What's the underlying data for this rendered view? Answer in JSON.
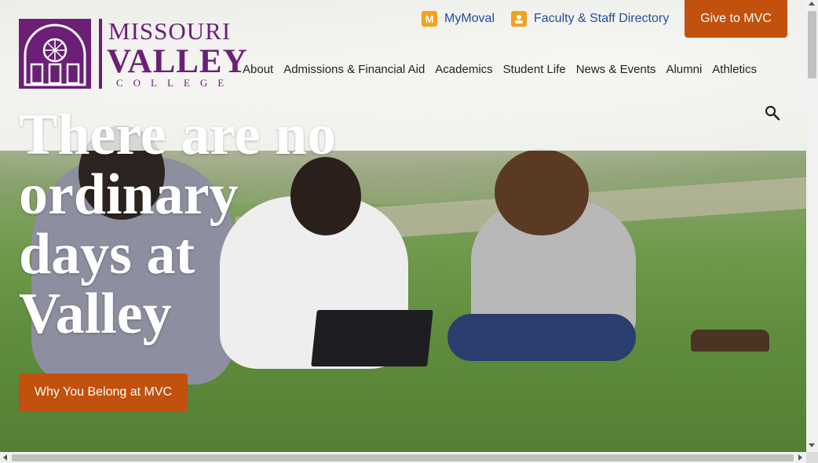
{
  "brand": {
    "line1": "MISSOURI",
    "line2": "VALLEY",
    "line3": "COLLEGE",
    "color": "#6b1f77"
  },
  "utility_links": [
    {
      "label": "MyMoval",
      "icon": "moval-m-icon"
    },
    {
      "label": "Faculty & Staff Directory",
      "icon": "contact-badge-icon"
    }
  ],
  "give_button": {
    "label": "Give to MVC",
    "color": "#c1510c"
  },
  "nav": {
    "items": [
      "About",
      "Admissions & Financial Aid",
      "Academics",
      "Student Life",
      "News & Events",
      "Alumni",
      "Athletics"
    ]
  },
  "search": {
    "icon": "search-icon"
  },
  "hero": {
    "headline": "There are no ordinary days at Valley",
    "cta_label": "Why You Belong at MVC"
  }
}
